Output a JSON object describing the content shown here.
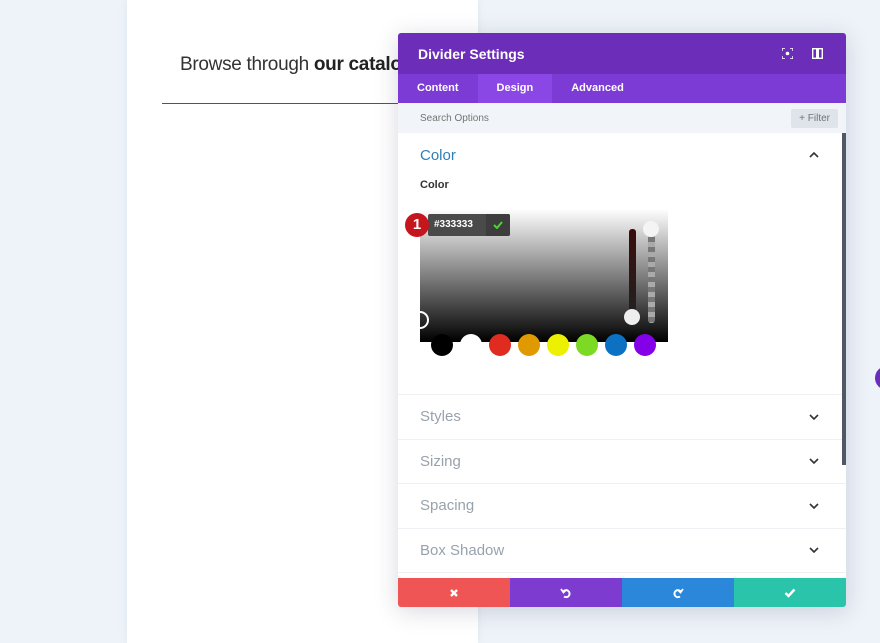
{
  "page": {
    "headline_regular": "Browse through ",
    "headline_bold": "our catalog"
  },
  "panel": {
    "title": "Divider Settings",
    "header_icons": [
      "focus-icon",
      "sidebar-toggle-icon"
    ],
    "tabs": [
      {
        "label": "Content",
        "active": false
      },
      {
        "label": "Design",
        "active": true
      },
      {
        "label": "Advanced",
        "active": false
      }
    ],
    "search": {
      "placeholder": "Search Options",
      "value": ""
    },
    "filter_label": "+ Filter",
    "color_section": {
      "title": "Color",
      "field_label": "Color",
      "hex_value": "#333333",
      "badge": "1",
      "swatches": [
        "#000000",
        "#ffffff",
        "#e02b20",
        "#e09900",
        "#edf000",
        "#7cda24",
        "#0c71c3",
        "#8300e9"
      ]
    },
    "sections": [
      {
        "title": "Styles"
      },
      {
        "title": "Sizing"
      },
      {
        "title": "Spacing"
      },
      {
        "title": "Box Shadow"
      }
    ],
    "footer": {
      "colors": {
        "cancel": "#ef5555",
        "undo": "#7e3bd0",
        "redo": "#2b87da",
        "save": "#29c4a9"
      }
    }
  },
  "colors": {
    "header": "#6c2eb9",
    "tabs": "#7d3bd6",
    "active_tab": "#8b46e6",
    "section_open": "#2e7fb8"
  }
}
